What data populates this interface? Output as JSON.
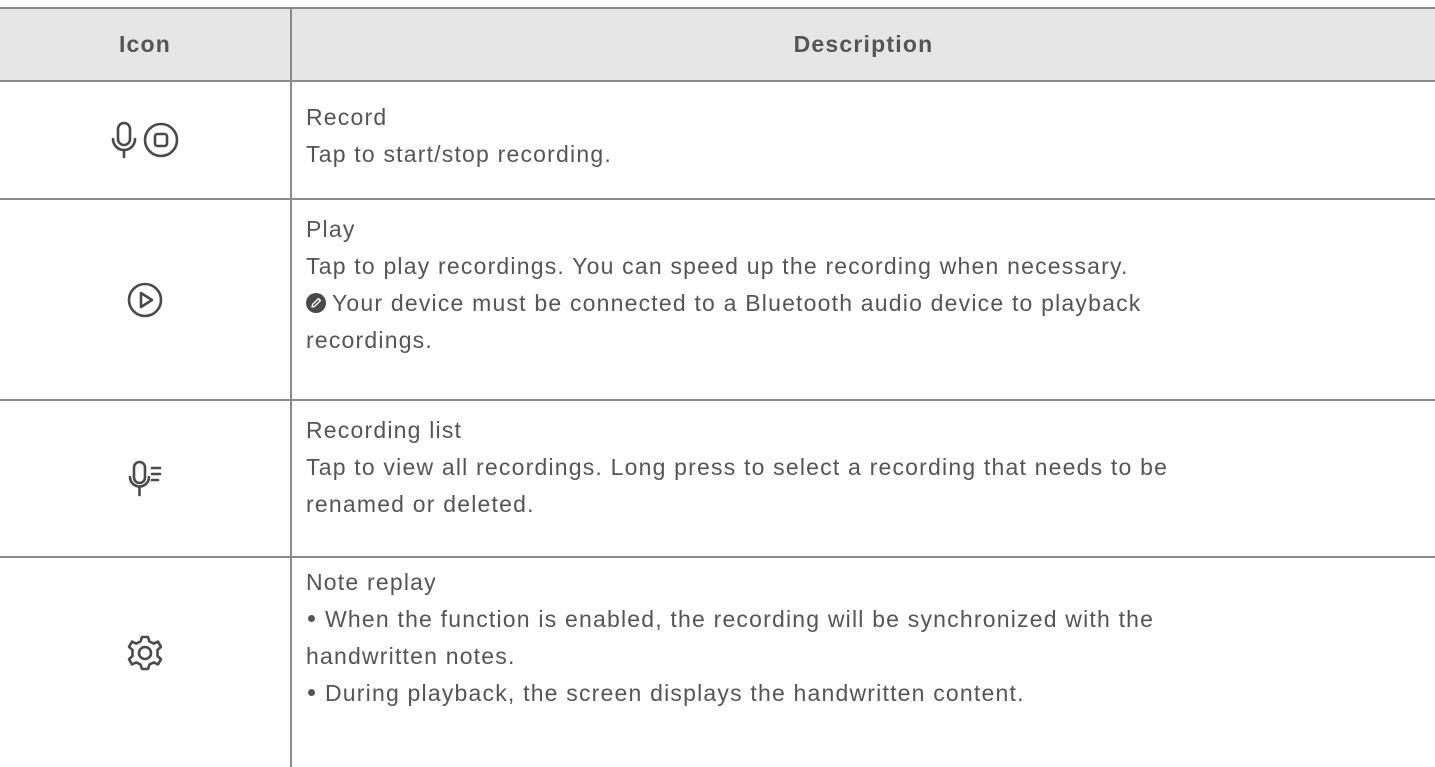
{
  "header": {
    "icon_col": "Icon",
    "desc_col": "Description"
  },
  "rows": [
    {
      "icons": [
        "microphone-icon",
        "stop-icon"
      ],
      "title": "Record",
      "lines": [
        "Tap to start/stop recording."
      ]
    },
    {
      "icons": [
        "play-icon"
      ],
      "title": "Play",
      "lines": [
        "Tap to play recordings. You can speed up the recording when necessary."
      ],
      "note_icon": "pencil-note-icon",
      "note_lines": [
        "Your device must be connected to a Bluetooth audio device to playback",
        "recordings."
      ]
    },
    {
      "icons": [
        "recording-list-icon"
      ],
      "title": "Recording list",
      "lines": [
        "Tap to view all recordings. Long press to select a recording that needs to be",
        "renamed or deleted."
      ]
    },
    {
      "icons": [
        "gear-icon"
      ],
      "title": "Note replay",
      "bullets": [
        [
          "When the function is enabled, the recording will be synchronized with the",
          "handwritten notes."
        ],
        [
          "During playback, the screen displays the handwritten content."
        ]
      ]
    }
  ],
  "colors": {
    "text": "#555555",
    "header_bg": "#e6e6e6",
    "rule": "#8a8a8a",
    "icon": "#4a4a4a"
  }
}
